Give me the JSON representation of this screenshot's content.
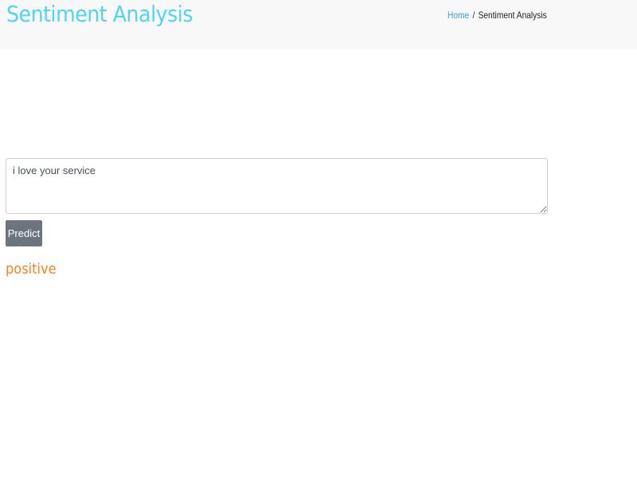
{
  "header": {
    "title": "Sentiment Analysis"
  },
  "breadcrumb": {
    "home": "Home",
    "separator": "/",
    "current": "Sentiment Analysis"
  },
  "form": {
    "text_value": "i love your service",
    "predict_label": "Predict"
  },
  "result": {
    "label": "positive"
  },
  "colors": {
    "title": "#4fd3f7",
    "result": "#f58220",
    "button": "#6c757d"
  }
}
